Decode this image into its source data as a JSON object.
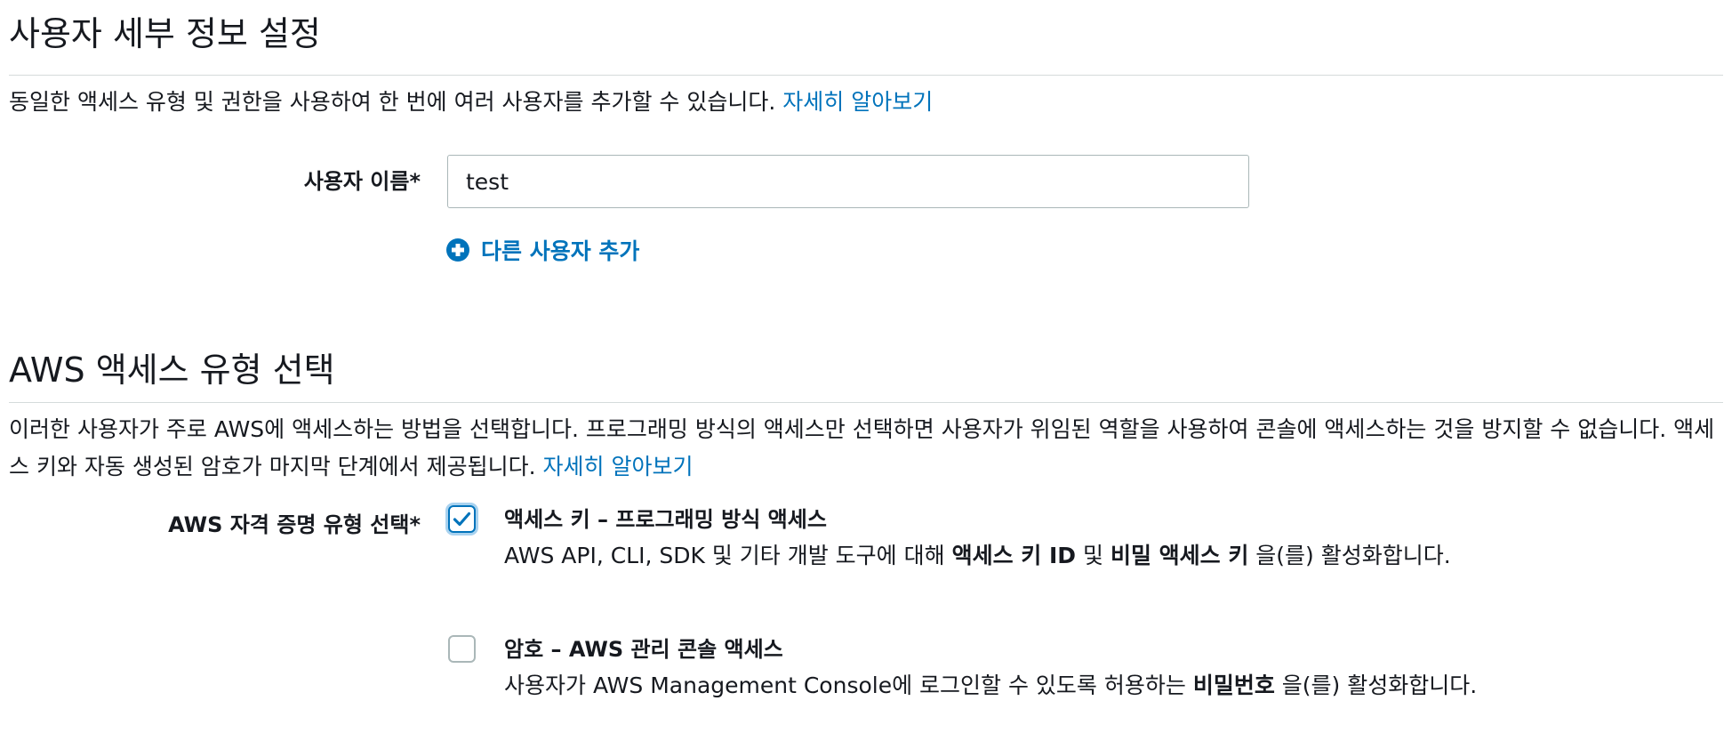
{
  "user_details": {
    "title": "사용자 세부 정보 설정",
    "description": "동일한 액세스 유형 및 권한을 사용하여 한 번에 여러 사용자를 추가할 수 있습니다.",
    "learn_more": "자세히 알아보기",
    "username_label": "사용자 이름*",
    "username_value": "test",
    "add_user_label": "다른 사용자 추가"
  },
  "access_type": {
    "title": "AWS 액세스 유형 선택",
    "description": "이러한 사용자가 주로 AWS에 액세스하는 방법을 선택합니다. 프로그래밍 방식의 액세스만 선택하면 사용자가 위임된 역할을 사용하여 콘솔에 액세스하는 것을 방지할 수 없습니다. 액세스 키와 자동 생성된 암호가 마지막 단계에서 제공됩니다.",
    "learn_more": "자세히 알아보기",
    "credential_label": "AWS 자격 증명 유형 선택*",
    "options": [
      {
        "title": "액세스 키 – 프로그래밍 방식 액세스",
        "checked": true,
        "desc_prefix": "AWS API, CLI, SDK 및 기타 개발 도구에 대해 ",
        "desc_bold1": "액세스 키 ID",
        "desc_mid": " 및 ",
        "desc_bold2": "비밀 액세스 키",
        "desc_suffix": " 을(를) 활성화합니다."
      },
      {
        "title": "암호 – AWS 관리 콘솔 액세스",
        "checked": false,
        "desc_prefix": "사용자가 AWS Management Console에 로그인할 수 있도록 허용하는 ",
        "desc_bold1": "비밀번호",
        "desc_suffix": " 을(를) 활성화합니다."
      }
    ]
  },
  "colors": {
    "link": "#0073bb",
    "text": "#16191f",
    "divider": "#d5dbdb",
    "checkbox_border": "#aab7b8"
  }
}
